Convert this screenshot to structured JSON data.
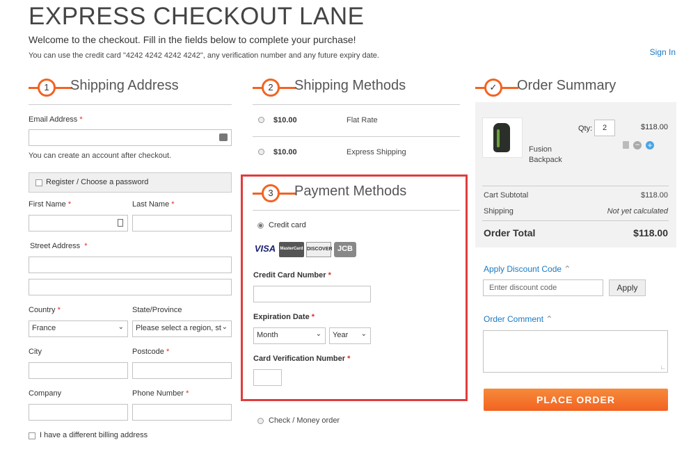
{
  "page": {
    "title": "EXPRESS CHECKOUT LANE",
    "welcome": "Welcome to the checkout. Fill in the fields below to complete your purchase!",
    "hint": "You can use the credit card \"4242 4242 4242 4242\", any verification number and any future expiry date.",
    "sign_in": "Sign In"
  },
  "shipping_address": {
    "step": "1",
    "title": "Shipping Address",
    "email_label": "Email Address",
    "email_note": "You can create an account after checkout.",
    "register_label": "Register / Choose a password",
    "first_name_label": "First Name",
    "last_name_label": "Last Name",
    "street_label": "Street Address",
    "country_label": "Country",
    "country_value": "France",
    "state_label": "State/Province",
    "state_value": "Please select a region, st",
    "city_label": "City",
    "postcode_label": "Postcode",
    "company_label": "Company",
    "phone_label": "Phone Number",
    "billing_label": "I have a different billing address"
  },
  "shipping_methods": {
    "step": "2",
    "title": "Shipping Methods",
    "options": [
      {
        "price": "$10.00",
        "name": "Flat Rate"
      },
      {
        "price": "$10.00",
        "name": "Express Shipping"
      }
    ]
  },
  "payment": {
    "step": "3",
    "title": "Payment Methods",
    "credit_card_label": "Credit card",
    "cards": [
      "VISA",
      "MasterCard",
      "DISCOVER",
      "JCB"
    ],
    "cc_number_label": "Credit Card Number",
    "expiration_label": "Expiration Date",
    "month_value": "Month",
    "year_value": "Year",
    "cvv_label": "Card Verification Number",
    "check_label": "Check / Money order"
  },
  "summary": {
    "step": "✓",
    "title": "Order Summary",
    "item_name": "Fusion Backpack",
    "qty_label": "Qty:",
    "qty_value": "2",
    "item_price": "$118.00",
    "subtotal_label": "Cart Subtotal",
    "subtotal_value": "$118.00",
    "shipping_label": "Shipping",
    "shipping_value": "Not yet calculated",
    "total_label": "Order Total",
    "total_value": "$118.00",
    "discount_link": "Apply Discount Code",
    "discount_placeholder": "Enter discount code",
    "apply_label": "Apply",
    "comment_link": "Order Comment",
    "place_order": "PLACE ORDER"
  },
  "colors": {
    "accent": "#f26322",
    "link": "#1979c3",
    "highlight": "#e03c3c"
  }
}
